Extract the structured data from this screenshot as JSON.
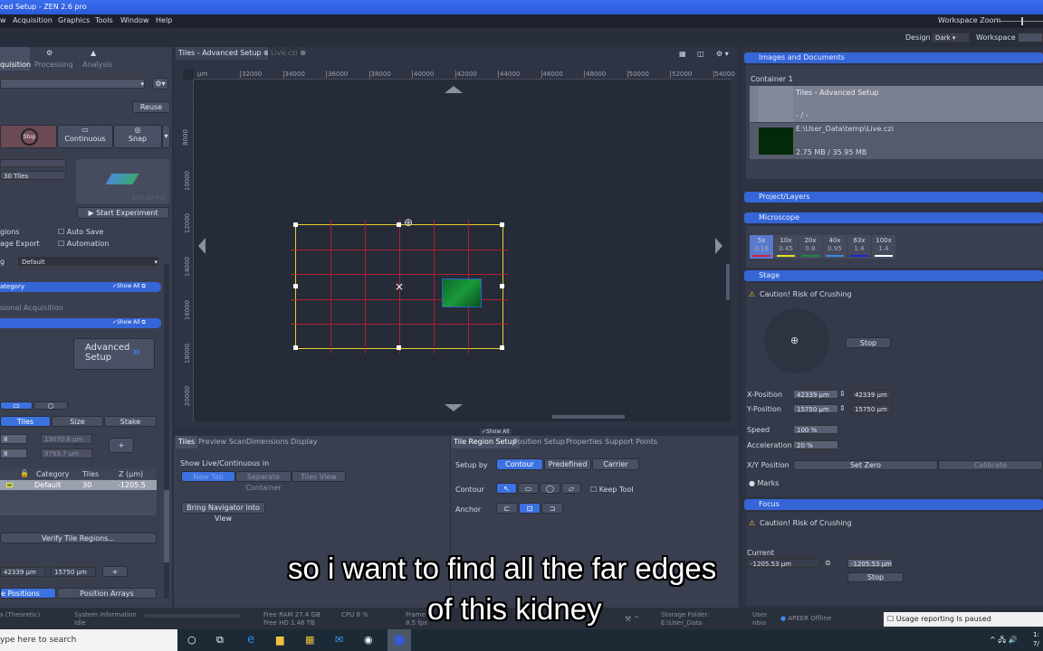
{
  "window": {
    "title": "ced Setup - ZEN 2.6 pro",
    "workspace_zoom_label": "Workspace Zoom",
    "design_label": "Design",
    "design_value": "Dark",
    "workspace_label": "Workspace"
  },
  "menu": [
    "w",
    "Acquisition",
    "Graphics",
    "Tools",
    "Window",
    "Help"
  ],
  "left": {
    "tabs": [
      "quisition",
      "Processing",
      "Analysis"
    ],
    "reuse": "Reuse",
    "stop": "Stop",
    "continuous": "Continuous",
    "snap": "Snap",
    "tiles_count": "30 Tiles",
    "size": "109.86 MB",
    "start": "Start Experiment",
    "opts": [
      "gions",
      "age Export"
    ],
    "auto_save": "Auto Save",
    "automation": "Automation",
    "setting_label": "g",
    "setting_value": "Default",
    "category": "ategory",
    "show_all": "Show All",
    "section2": "sional Acquisition",
    "advanced_setup": "Advanced Setup",
    "seg_tabs": [
      "Tiles",
      "Size",
      "Stake"
    ],
    "tiles_x": "8",
    "tiles_y": "8",
    "width": "13070.8 µm",
    "height": "9793.7 µm",
    "table_headers": [
      "Category",
      "Tiles",
      "Z (µm)"
    ],
    "table_rows": [
      {
        "category": "Default",
        "tiles": "30",
        "z": "-1205.5"
      }
    ],
    "verify": "Verify Tile Regions...",
    "pos_x": "42339 µm",
    "pos_y": "15750 µm",
    "pos_tabs": [
      "e Positions",
      "Position Arrays"
    ]
  },
  "doc_tabs": [
    {
      "label": "Tiles - Advanced Setup"
    },
    {
      "label": "Live.czi"
    }
  ],
  "ruler": {
    "unit": "µm",
    "x": [
      32000,
      34000,
      36000,
      38000,
      40000,
      42000,
      44000,
      46000,
      48000,
      50000,
      52000,
      54000
    ],
    "y": [
      8000,
      10000,
      12000,
      14000,
      16000,
      18000,
      20000
    ]
  },
  "tile_region": {
    "columns": 6,
    "rows": 5
  },
  "bottom_left": {
    "tabs": [
      "Tiles",
      "Preview Scan",
      "Dimensions",
      "Display"
    ],
    "show_live": "Show Live/Continuous in",
    "segs": [
      "New Tab",
      "Separate Container",
      "Tiles View"
    ],
    "bring_nav": "Bring Navigator into View",
    "show_all": "Show All"
  },
  "bottom_right": {
    "tabs": [
      "Tile Region Setup",
      "Position Setup",
      "Properties",
      "Support Points"
    ],
    "setup_by": "Setup by",
    "setup_opts": [
      "Contour",
      "Predefined",
      "Carrier"
    ],
    "contour": "Contour",
    "keep_tool": "Keep Tool",
    "anchor": "Anchor"
  },
  "right": {
    "images_docs": "Images and Documents",
    "container": "Container 1",
    "docs": [
      {
        "name": "Tiles - Advanced Setup",
        "info": "- / -"
      },
      {
        "name": "E:\\User_Data\\temp\\Live.czi",
        "info": "2.75 MB / 35.95 MB"
      }
    ],
    "project": "Project/Layers",
    "microscope": "Microscope",
    "objectives": [
      {
        "mag": "5x",
        "na": "0.16",
        "color": "#d0203a"
      },
      {
        "mag": "10x",
        "na": "0.45",
        "color": "#e8e020"
      },
      {
        "mag": "20x",
        "na": "0.8",
        "color": "#1e8a3a"
      },
      {
        "mag": "40x",
        "na": "0.95",
        "color": "#3a8ad8"
      },
      {
        "mag": "63x",
        "na": "1.4",
        "color": "#1a2ad0"
      },
      {
        "mag": "100x",
        "na": "1.4",
        "color": "#ffffff"
      }
    ],
    "stage": "Stage",
    "caution": "Caution! Risk of Crushing",
    "stop": "Stop",
    "x_label": "X-Position",
    "x_value": "42339 µm",
    "x_read": "42339 µm",
    "y_label": "Y-Position",
    "y_value": "15750 µm",
    "y_read": "15750 µm",
    "speed_label": "Speed",
    "speed": "100 %",
    "accel_label": "Acceleration",
    "accel": "20 %",
    "xy_label": "X/Y Position",
    "set_zero": "Set Zero",
    "calibrate": "Calibrate",
    "marks": "Marks",
    "focus": "Focus",
    "current": "Current",
    "focus_current": "-1205.53 µm",
    "focus_value": "-1205.53 µm"
  },
  "status": {
    "theoretic": "s (Theoretic)",
    "sysinfo": "System Information",
    "idle": "Idle",
    "ram": "Free RAM 27.4 GB",
    "hd": "Free HD   1.46 TB",
    "cpu": "CPU 8 %",
    "frame": "Frame",
    "fps": "8.5 fps",
    "storage": "Storage Folder:",
    "storage_path": "E:\\User_Data",
    "user": "User:",
    "user_name": "nbio",
    "apeer": "APEER Offline",
    "usage": "Usage reporting Is paused"
  },
  "taskbar": {
    "search": "ype here to search",
    "time": "1:",
    "date": "7/"
  },
  "subtitles": [
    "so i want to find all the far edges",
    "of this kidney"
  ]
}
